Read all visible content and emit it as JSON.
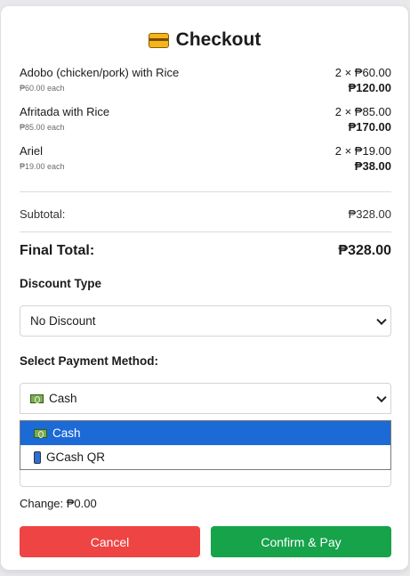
{
  "title": "Checkout",
  "items": [
    {
      "name": "Adobo (chicken/pork) with Rice",
      "each": "₱60.00 each",
      "qty": "2 × ₱60.00",
      "total": "₱120.00"
    },
    {
      "name": "Afritada with Rice",
      "each": "₱85.00 each",
      "qty": "2 × ₱85.00",
      "total": "₱170.00"
    },
    {
      "name": "Ariel",
      "each": "₱19.00 each",
      "qty": "2 × ₱19.00",
      "total": "₱38.00"
    }
  ],
  "summary": {
    "subtotal_label": "Subtotal:",
    "subtotal_value": "₱328.00",
    "final_label": "Final Total:",
    "final_value": "₱328.00"
  },
  "discount": {
    "label": "Discount Type",
    "selected": "No Discount"
  },
  "payment": {
    "label": "Select Payment Method:",
    "selected": "Cash",
    "options": [
      {
        "label": "Cash",
        "icon": "cash-icon"
      },
      {
        "label": "GCash QR",
        "icon": "phone-icon"
      }
    ]
  },
  "change": "Change: ₱0.00",
  "buttons": {
    "cancel": "Cancel",
    "confirm": "Confirm & Pay"
  },
  "colors": {
    "cancel": "#ef4444",
    "confirm": "#16a34a",
    "selected_option": "#1b6ad6"
  }
}
